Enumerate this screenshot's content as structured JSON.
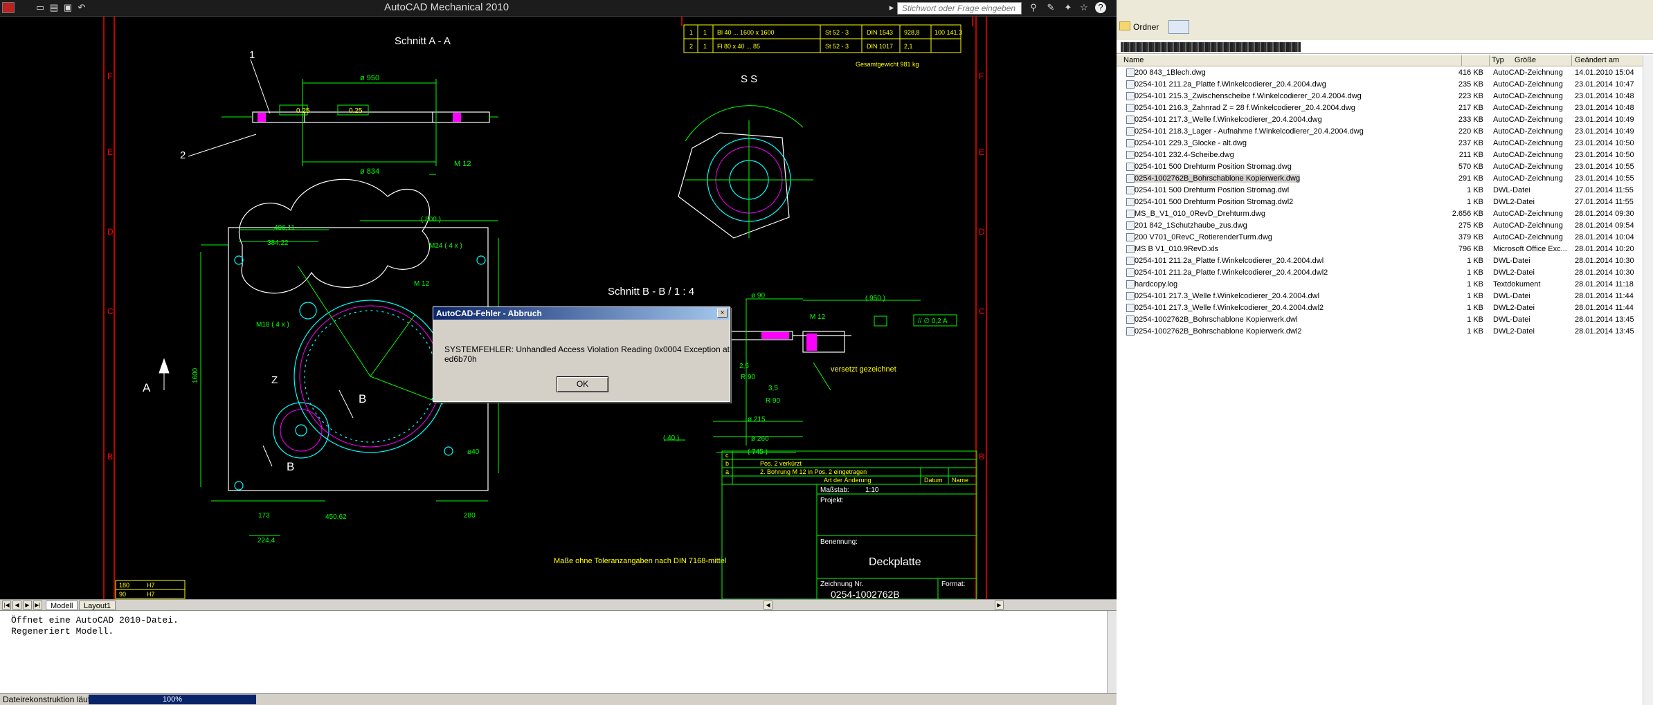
{
  "app": {
    "title": "AutoCAD Mechanical 2010",
    "help_placeholder": "Stichwort oder Frage eingeben"
  },
  "tabs": {
    "model": "Modell",
    "layout1": "Layout1"
  },
  "command_lines": [
    "Öffnet eine  AutoCAD 2010-Datei.",
    "Regeneriert Modell."
  ],
  "status": {
    "text": "Dateirekonstruktion läuft",
    "progress": "100%",
    "progress_value": 1.0
  },
  "dialog": {
    "title": "AutoCAD-Fehler - Abbruch",
    "message": "SYSTEMFEHLER:  Unhandled Access Violation Reading 0x0004 Exception at ed6b70h",
    "ok": "OK",
    "close": "×"
  },
  "drawing": {
    "schnitt_aa": "Schnitt  A - A",
    "schnitt_bb": "Schnitt  B - B  /  1 : 4",
    "ss": "S S",
    "label_1": "1",
    "label_2": "2",
    "label_a": "A",
    "label_b": "B",
    "label_z": "Z",
    "label_b2": "B",
    "dims": {
      "d950": "ø 950",
      "d834": "ø 834",
      "m12": "M 12",
      "m12b": "M 12",
      "m24": "M24 ( 4 x )",
      "m18": "M18 ( 4 x )",
      "d406": "406,11",
      "d384": "384,22",
      "d800": "( 800 )",
      "d1600": "1600",
      "d450": "450,62",
      "d173": "173",
      "d224": "224,4",
      "d280": "280",
      "d40": "ø40",
      "d90": "ø 90",
      "d950b": "( 950 )",
      "d215": "ø 215",
      "d260": "ø 260",
      "d745": "( 745 )",
      "d40b": "( 40 )",
      "d25": "2,5",
      "d35": "3,5",
      "r90": "R 90",
      "r90b": "R 90",
      "versetzt": "versetzt gezeichnet",
      "toleranz": "Maße ohne Toleranzangaben nach DIN 7168-mittel",
      "gesamt": "Gesamtgewicht   981 kg",
      "tol1": "0.25",
      "tol2": "0.25",
      "tol3": "//  ∅ 0,2  A"
    },
    "table_rows": [
      [
        "1",
        "1",
        "Bl 40 ... 1600 x 1600",
        "St 52 - 3",
        "DIN 1543",
        "928,8",
        "100 141.3"
      ],
      [
        "2",
        "1",
        "Fl 80 x 40 ... 85",
        "St 52 - 3",
        "DIN 1017",
        "2,1",
        ""
      ]
    ],
    "title_block": {
      "benennung_label": "Benennung:",
      "benennung": "Deckplatte",
      "projekt": "Projekt:",
      "zeichnung_label": "Zeichnung  Nr.",
      "zeichnung": "0254-1002762B",
      "format": "Format:",
      "massstab": "Maßstab:",
      "massstab_val": "1:10",
      "rev_c": "c",
      "rev_b": "b",
      "rev_a": "a",
      "rev_b_txt": "Pos. 2 verkürzt",
      "rev_a_txt": "2. Bohrung  M 12 in Pos. 2 eingetragen",
      "aenderung": "Art der Änderung",
      "datum": "Datum",
      "name": "Name"
    },
    "fits": [
      [
        "180",
        "H7"
      ],
      [
        "90",
        "H7"
      ]
    ]
  },
  "explorer": {
    "ordner": "Ordner",
    "columns": {
      "name": "Name",
      "size": "Größe",
      "type": "Typ",
      "changed": "Geändert am"
    },
    "files": [
      [
        "200 843_1Blech.dwg",
        "416 KB",
        "AutoCAD-Zeichnung",
        "14.01.2010 15:04"
      ],
      [
        "0254-101 211.2a_Platte f.Winkelcodierer_20.4.2004.dwg",
        "235 KB",
        "AutoCAD-Zeichnung",
        "23.01.2014 10:47"
      ],
      [
        "0254-101 215.3_Zwischenscheibe f.Winkelcodierer_20.4.2004.dwg",
        "223 KB",
        "AutoCAD-Zeichnung",
        "23.01.2014 10:48"
      ],
      [
        "0254-101 216.3_Zahnrad Z = 28 f.Winkelcodierer_20.4.2004.dwg",
        "217 KB",
        "AutoCAD-Zeichnung",
        "23.01.2014 10:48"
      ],
      [
        "0254-101 217.3_Welle f.Winkelcodierer_20.4.2004.dwg",
        "233 KB",
        "AutoCAD-Zeichnung",
        "23.01.2014 10:49"
      ],
      [
        "0254-101 218.3_Lager - Aufnahme f.Winkelcodierer_20.4.2004.dwg",
        "220 KB",
        "AutoCAD-Zeichnung",
        "23.01.2014 10:49"
      ],
      [
        "0254-101 229.3_Glocke - alt.dwg",
        "237 KB",
        "AutoCAD-Zeichnung",
        "23.01.2014 10:50"
      ],
      [
        "0254-101 232.4-Scheibe.dwg",
        "211 KB",
        "AutoCAD-Zeichnung",
        "23.01.2014 10:50"
      ],
      [
        "0254-101 500 Drehturm Position Stromag.dwg",
        "570 KB",
        "AutoCAD-Zeichnung",
        "23.01.2014 10:55"
      ],
      [
        "0254-1002762B_Bohrschablone Kopierwerk.dwg",
        "291 KB",
        "AutoCAD-Zeichnung",
        "23.01.2014 10:55"
      ],
      [
        "0254-101 500 Drehturm Position Stromag.dwl",
        "1 KB",
        "DWL-Datei",
        "27.01.2014 11:55"
      ],
      [
        "0254-101 500 Drehturm Position Stromag.dwl2",
        "1 KB",
        "DWL2-Datei",
        "27.01.2014 11:55"
      ],
      [
        "MS_B_V1_010_0RevD_Drehturm.dwg",
        "2.656 KB",
        "AutoCAD-Zeichnung",
        "28.01.2014 09:30"
      ],
      [
        "201 842_1Schutzhaube_zus.dwg",
        "275 KB",
        "AutoCAD-Zeichnung",
        "28.01.2014 09:54"
      ],
      [
        "200 V701_0RevC_RotierenderTurm.dwg",
        "379 KB",
        "AutoCAD-Zeichnung",
        "28.01.2014 10:04"
      ],
      [
        "MS B V1_010.9RevD.xls",
        "796 KB",
        "Microsoft Office Exc...",
        "28.01.2014 10:20"
      ],
      [
        "0254-101 211.2a_Platte f.Winkelcodierer_20.4.2004.dwl",
        "1 KB",
        "DWL-Datei",
        "28.01.2014 10:30"
      ],
      [
        "0254-101 211.2a_Platte f.Winkelcodierer_20.4.2004.dwl2",
        "1 KB",
        "DWL2-Datei",
        "28.01.2014 10:30"
      ],
      [
        "hardcopy.log",
        "1 KB",
        "Textdokument",
        "28.01.2014 11:18"
      ],
      [
        "0254-101 217.3_Welle f.Winkelcodierer_20.4.2004.dwl",
        "1 KB",
        "DWL-Datei",
        "28.01.2014 11:44"
      ],
      [
        "0254-101 217.3_Welle f.Winkelcodierer_20.4.2004.dwl2",
        "1 KB",
        "DWL2-Datei",
        "28.01.2014 11:44"
      ],
      [
        "0254-1002762B_Bohrschablone Kopierwerk.dwl",
        "1 KB",
        "DWL-Datei",
        "28.01.2014 13:45"
      ],
      [
        "0254-1002762B_Bohrschablone Kopierwerk.dwl2",
        "1 KB",
        "DWL2-Datei",
        "28.01.2014 13:45"
      ]
    ],
    "selected_index": 9
  },
  "colors": {
    "cad_bg": "#000000",
    "green": "#00ff00",
    "yellow": "#ffff00",
    "red": "#ff0000",
    "cyan": "#00ffff",
    "magenta": "#ff00ff",
    "white": "#ffffff"
  }
}
